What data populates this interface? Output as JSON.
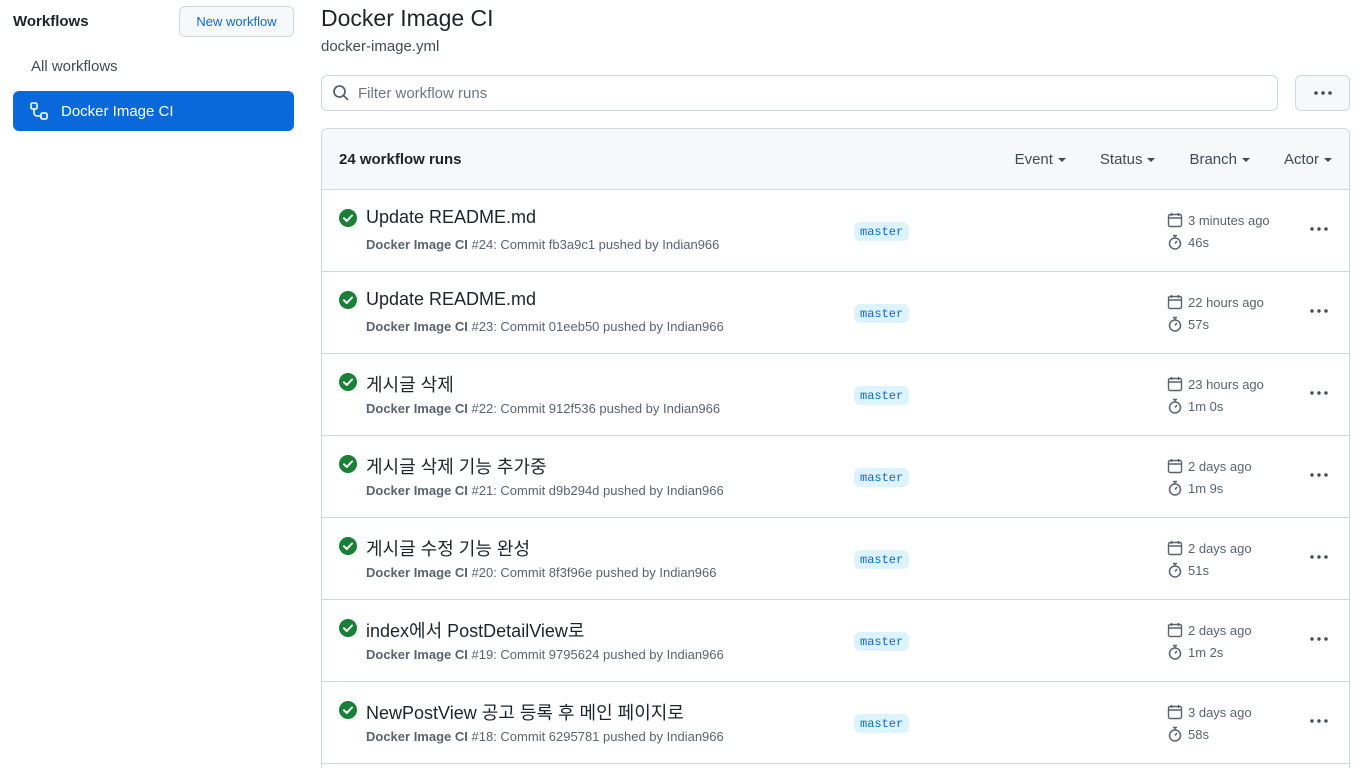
{
  "sidebar": {
    "title": "Workflows",
    "new_workflow_label": "New workflow",
    "all_workflows_label": "All workflows",
    "active_workflow_label": "Docker Image CI"
  },
  "main": {
    "title": "Docker Image CI",
    "subtitle": "docker-image.yml",
    "search_placeholder": "Filter workflow runs"
  },
  "runs_header": {
    "count_label": "24 workflow runs",
    "filters": [
      "Event",
      "Status",
      "Branch",
      "Actor"
    ]
  },
  "colors": {
    "accent": "#0969da",
    "success": "#1a7f37",
    "branch_bg": "#ddf4ff"
  },
  "runs": [
    {
      "title": "Update README.md",
      "workflow": "Docker Image CI",
      "meta": "#24: Commit fb3a9c1 pushed by Indian966",
      "branch": "master",
      "time": "3 minutes ago",
      "duration": "46s"
    },
    {
      "title": "Update README.md",
      "workflow": "Docker Image CI",
      "meta": "#23: Commit 01eeb50 pushed by Indian966",
      "branch": "master",
      "time": "22 hours ago",
      "duration": "57s"
    },
    {
      "title": "게시글 삭제",
      "workflow": "Docker Image CI",
      "meta": "#22: Commit 912f536 pushed by Indian966",
      "branch": "master",
      "time": "23 hours ago",
      "duration": "1m 0s"
    },
    {
      "title": "게시글 삭제 기능 추가중",
      "workflow": "Docker Image CI",
      "meta": "#21: Commit d9b294d pushed by Indian966",
      "branch": "master",
      "time": "2 days ago",
      "duration": "1m 9s"
    },
    {
      "title": "게시글 수정 기능 완성",
      "workflow": "Docker Image CI",
      "meta": "#20: Commit 8f3f96e pushed by Indian966",
      "branch": "master",
      "time": "2 days ago",
      "duration": "51s"
    },
    {
      "title": "index에서 PostDetailView로",
      "workflow": "Docker Image CI",
      "meta": "#19: Commit 9795624 pushed by Indian966",
      "branch": "master",
      "time": "2 days ago",
      "duration": "1m 2s"
    },
    {
      "title": "NewPostView 공고 등록 후 메인 페이지로",
      "workflow": "Docker Image CI",
      "meta": "#18: Commit 6295781 pushed by Indian966",
      "branch": "master",
      "time": "3 days ago",
      "duration": "58s"
    }
  ]
}
